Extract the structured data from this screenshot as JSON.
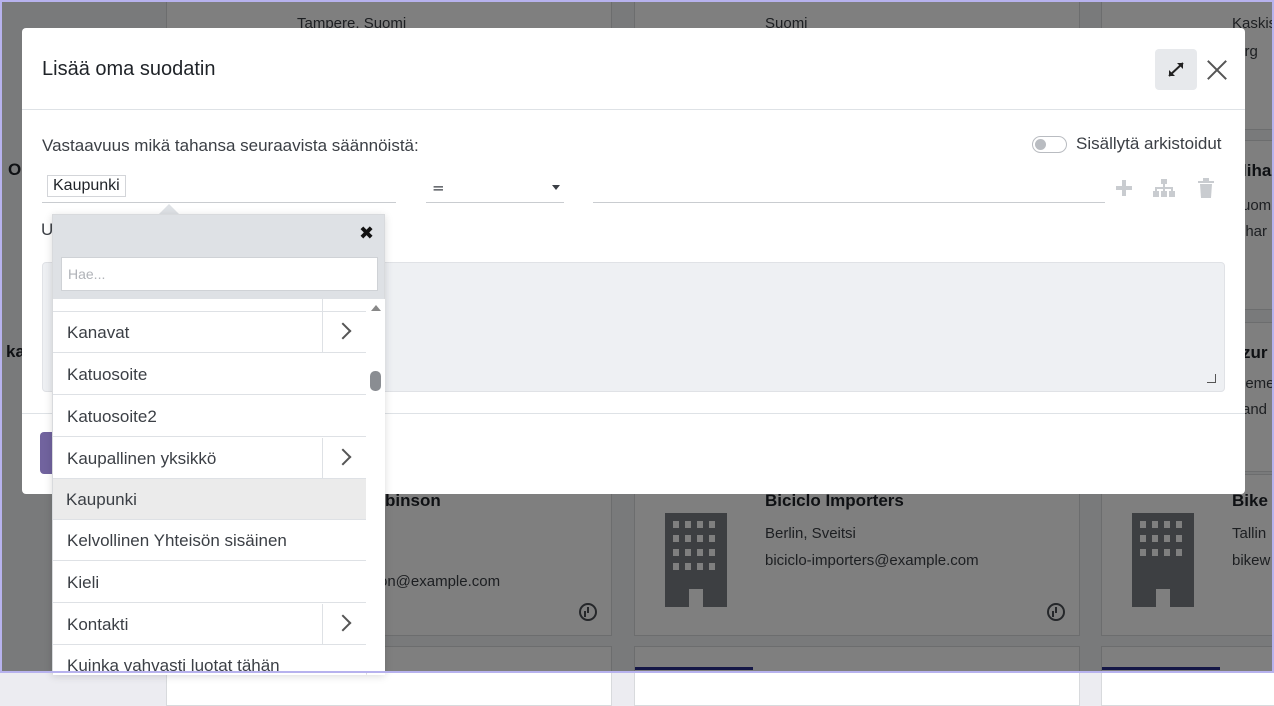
{
  "background": {
    "cards": [
      {
        "line1": "Tampere, Suomi"
      },
      {
        "line1": "Suomi"
      },
      {
        "line1": "Kaskis",
        "line2": "targ"
      },
      {
        "title_partial": "O"
      },
      {
        "title_partial": "liha",
        "line1": "uom",
        "line2": "ihar"
      },
      {
        "title_partial": "ka"
      },
      {
        "title_partial": "zur",
        "line1": "ieme",
        "line2": "and"
      },
      {
        "title": "binson",
        "line1": "on@example.com"
      },
      {
        "title": "Biciclo Importers",
        "line1": "Berlin, Sveitsi",
        "line2": "biciclo-importers@example.com"
      },
      {
        "title": "Bike",
        "line1": "Tallin",
        "line2": "bikew"
      }
    ]
  },
  "modal": {
    "title": "Lisää oma suodatin",
    "rule_text": "Vastaavuus mikä tahansa seuraavista säännöistä:",
    "include_archived": "Sisällytä arkistoidut",
    "field_path": "Kaupunki",
    "operator": "=",
    "partial_label": "U"
  },
  "popover": {
    "search_placeholder": "Hae...",
    "items": [
      {
        "label": "Kanavat",
        "has_children": true
      },
      {
        "label": "Katuosoite",
        "has_children": false
      },
      {
        "label": "Katuosoite2",
        "has_children": false
      },
      {
        "label": "Kaupallinen yksikkö",
        "has_children": true
      },
      {
        "label": "Kaupunki",
        "has_children": false,
        "active": true
      },
      {
        "label": "Kelvollinen Yhteisön sisäinen",
        "has_children": false
      },
      {
        "label": "Kieli",
        "has_children": false
      },
      {
        "label": "Kontakti",
        "has_children": true
      },
      {
        "label": "Kuinka vahvasti luotat tähän",
        "has_children": false
      }
    ]
  },
  "icons": [
    "expand-icon",
    "close-icon",
    "plus-icon",
    "hierarchy-icon",
    "trash-icon",
    "clock-icon",
    "building-icon",
    "chevron-right-icon"
  ]
}
